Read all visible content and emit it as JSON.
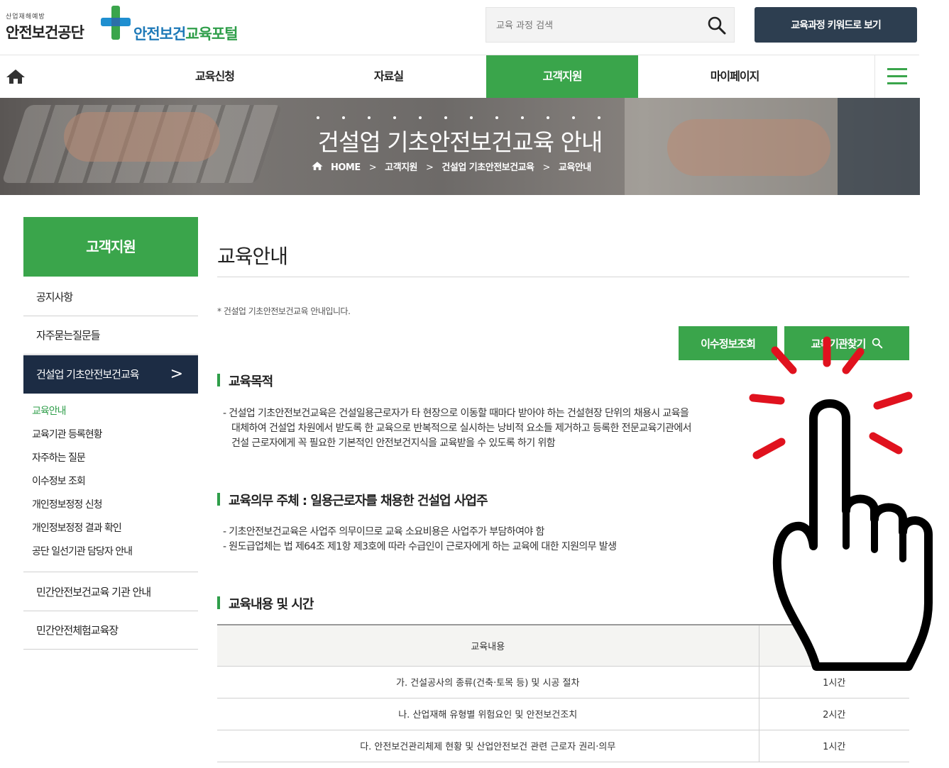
{
  "header": {
    "logo_org_small": "산업재해예방",
    "logo_org": "안전보건공단",
    "logo_portal_a": "안전보건",
    "logo_portal_b": "교육포털",
    "search_placeholder": "교육 과정 검색",
    "keyword_button": "교육과정 키워드로 보기"
  },
  "nav": {
    "items": [
      "교육신청",
      "자료실",
      "고객지원",
      "마이페이지"
    ],
    "active": "고객지원"
  },
  "banner": {
    "title": "건설업 기초안전보건교육 안내",
    "breadcrumb": [
      "HOME",
      "고객지원",
      "건설업 기초안전보건교육",
      "교육안내"
    ]
  },
  "sidebar": {
    "title": "고객지원",
    "items": [
      "공지사항",
      "자주묻는질문들",
      "건설업 기초안전보건교육"
    ],
    "sub_items": [
      "교육안내",
      "교육기관 등록현황",
      "자주하는 질문",
      "이수정보 조회",
      "개인정보정정 신청",
      "개인정보정정 결과 확인",
      "공단 일선기관 담당자 안내"
    ],
    "bottom_items": [
      "민간안전보건교육 기관 안내",
      "민간안전체험교육장"
    ]
  },
  "content": {
    "title": "교육안내",
    "notice": "* 건설업 기초안전보건교육 안내입니다.",
    "btn_completion": "이수정보조회",
    "btn_find": "교육기관찾기",
    "sec1_title": "교육목적",
    "sec1_lines": [
      "- 건설업 기초안전보건교육은 건설일용근로자가 타 현장으로 이동할 때마다 받아야 하는 건설현장 단위의 채용시 교육을",
      "  대체하여 건설업 차원에서 받도록 한 교육으로 반복적으로 실시하는 낭비적 요소들 제거하고 등록한 전문교육기관에서",
      "  건설 근로자에게 꼭 필요한 기본적인 안전보건지식을 교육받을 수 있도록 하기 위함"
    ],
    "sec2_title": "교육의무 주체 : 일용근로자를 채용한 건설업 사업주",
    "sec2_lines": [
      "- 기초안전보건교육은 사업주 의무이므로 교육 소요비용은 사업주가 부담하여야 함",
      "- 원도급업체는 법 제64조 제1항 제3호에 따라 수급인이 근로자에게 하는 교육에 대한 지원의무 발생"
    ],
    "sec3_title": "교육내용 및 시간",
    "table": {
      "header": [
        "교육내용",
        ""
      ],
      "rows": [
        [
          "가. 건설공사의 종류(건축·토목 등) 및 시공 절차",
          "1시간"
        ],
        [
          "나. 산업재해 유형별 위험요인 및 안전보건조치",
          "2시간"
        ],
        [
          "다. 안전보건관리체제 현황 및 산업안전보건 관련 근로자 권리·의무",
          "1시간"
        ]
      ]
    }
  },
  "colors": {
    "green": "#3aa54b",
    "navy": "#1c2c44",
    "dark_button": "#2d3e50",
    "tap_red": "#e0121e"
  },
  "icons": [
    "home-icon",
    "search-icon",
    "hamburger-icon",
    "chevron-right-icon",
    "pointing-hand-icon"
  ]
}
